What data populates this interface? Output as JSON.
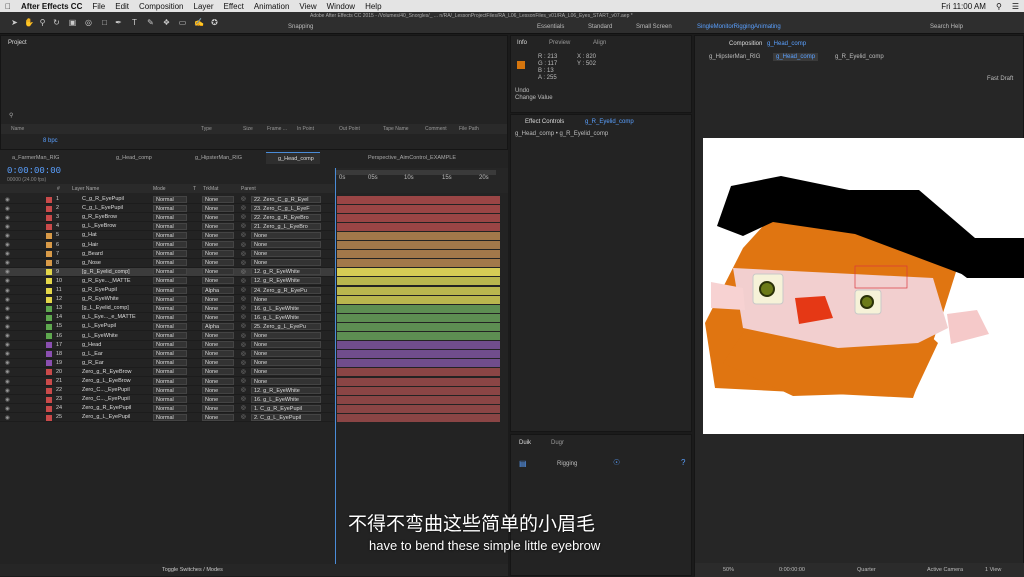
{
  "menubar": {
    "app": "After Effects CC",
    "items": [
      "File",
      "Edit",
      "Composition",
      "Layer",
      "Effect",
      "Animation",
      "View",
      "Window",
      "Help"
    ],
    "title": "Adobe After Effects CC 2015 - /Volumes/40_Snorgles/_ ... n/RA/_LessonProjectFiles/RA_L06_LessonFiles_v01/RA_L06_Eyes_START_v07.aep *",
    "clock": "Fri 11:00 AM"
  },
  "toolbar": {
    "snapping": "Snapping",
    "workspaces": [
      "Essentials",
      "Standard",
      "Small Screen",
      "SingleMonitorRiggingAnimating"
    ],
    "search": "Search Help"
  },
  "project": {
    "title": "Project",
    "bpc": "8 bpc",
    "columns": [
      "Name",
      "Type",
      "Size",
      "Frame ...",
      "In Point",
      "Out Point",
      "Tape Name",
      "Comment",
      "File Path"
    ]
  },
  "info": {
    "tabs": [
      "Info",
      "Preview",
      "Align"
    ],
    "r": "R : 213",
    "g": "G : 117",
    "b": "B : 13",
    "a": "A : 255",
    "x": "X : 820",
    "y": "Y : 502",
    "undo": "Undo",
    "undo_action": "Change Value"
  },
  "effects": {
    "title": "Effect Controls",
    "target": "g_R_Eyelid_comp",
    "breadcrumb": "g_Head_comp • g_R_Eyelid_comp"
  },
  "duik": {
    "tabs": [
      "Duik",
      "Dugr"
    ],
    "section": "Rigging"
  },
  "comp": {
    "title": "Composition",
    "name": "g_Head_comp",
    "tabs": [
      "g_HipsterMan_RIG",
      "g_Head_comp",
      "g_R_Eyelid_comp"
    ],
    "draft": "Fast Draft",
    "zoom": "50%",
    "time": "0:00:00:00",
    "quality": "Quarter",
    "camera": "Active Camera",
    "views": "1 View"
  },
  "timeline": {
    "tabs": [
      "a_FarmerMan_RIG",
      "g_Head_comp",
      "g_HipsterMan_RIG",
      "g_Head_comp",
      "Perspective_AimControl_EXAMPLE"
    ],
    "timecode": "0:00:00:00",
    "fps": "00000 (24.00 fps)",
    "columns": [
      "#",
      "Layer Name",
      "Mode",
      "T",
      "TrkMat",
      "Parent"
    ],
    "ruler": [
      "0s",
      "05s",
      "10s",
      "15s",
      "20s"
    ],
    "toggle": "Toggle Switches / Modes",
    "layers": [
      {
        "n": "1",
        "name": "C_g_R_EyePupil",
        "mode": "Normal",
        "trk": "None",
        "parent": "22. Zero_C_g_R_Eyel",
        "color": "#c94a4a",
        "bar": "#9a4545"
      },
      {
        "n": "2",
        "name": "C_g_L_EyePupil",
        "mode": "Normal",
        "trk": "None",
        "parent": "23. Zero_C_g_L_EyeF",
        "color": "#c94a4a",
        "bar": "#9a4545"
      },
      {
        "n": "3",
        "name": "g_R_EyeBrow",
        "mode": "Normal",
        "trk": "None",
        "parent": "22. Zero_g_R_EyeBro",
        "color": "#c94a4a",
        "bar": "#9a4545"
      },
      {
        "n": "4",
        "name": "g_L_EyeBrow",
        "mode": "Normal",
        "trk": "None",
        "parent": "21. Zero_g_L_EyeBro",
        "color": "#c94a4a",
        "bar": "#9a4545"
      },
      {
        "n": "5",
        "name": "g_Hat",
        "mode": "Normal",
        "trk": "None",
        "parent": "None",
        "color": "#d89a48",
        "bar": "#a2784a"
      },
      {
        "n": "6",
        "name": "g_Hair",
        "mode": "Normal",
        "trk": "None",
        "parent": "None",
        "color": "#d89a48",
        "bar": "#a2784a"
      },
      {
        "n": "7",
        "name": "g_Beard",
        "mode": "Normal",
        "trk": "None",
        "parent": "None",
        "color": "#d89a48",
        "bar": "#a2784a"
      },
      {
        "n": "8",
        "name": "g_Nose",
        "mode": "Normal",
        "trk": "None",
        "parent": "None",
        "color": "#d89a48",
        "bar": "#a2784a"
      },
      {
        "n": "9",
        "name": "[g_R_Eyelid_comp]",
        "mode": "Normal",
        "trk": "None",
        "parent": "12. g_R_EyeWhite",
        "color": "#e3d64a",
        "bar": "#d6cc55",
        "sel": true
      },
      {
        "n": "10",
        "name": "g_R_Eye..._MATTE",
        "mode": "Normal",
        "trk": "None",
        "parent": "12. g_R_EyeWhite",
        "color": "#e3d64a",
        "bar": "#b9b64e"
      },
      {
        "n": "11",
        "name": "g_R_EyePupil",
        "mode": "Normal",
        "trk": "Alpha",
        "parent": "24. Zero_g_R_EyePu",
        "color": "#e3d64a",
        "bar": "#b9b64e"
      },
      {
        "n": "12",
        "name": "g_R_EyeWhite",
        "mode": "Normal",
        "trk": "None",
        "parent": "None",
        "color": "#e3d64a",
        "bar": "#b9b64e"
      },
      {
        "n": "13",
        "name": "[g_L_Eyelid_comp]",
        "mode": "Normal",
        "trk": "None",
        "parent": "16. g_L_EyeWhite",
        "color": "#5fa84f",
        "bar": "#5d8e52"
      },
      {
        "n": "14",
        "name": "g_L_Eye..._e_MATTE",
        "mode": "Normal",
        "trk": "None",
        "parent": "16. g_L_EyeWhite",
        "color": "#5fa84f",
        "bar": "#5d8e52"
      },
      {
        "n": "15",
        "name": "g_L_EyePupil",
        "mode": "Normal",
        "trk": "Alpha",
        "parent": "25. Zero_g_L_EyePu",
        "color": "#5fa84f",
        "bar": "#5d8e52"
      },
      {
        "n": "16",
        "name": "g_L_EyeWhite",
        "mode": "Normal",
        "trk": "None",
        "parent": "None",
        "color": "#5fa84f",
        "bar": "#5d8e52"
      },
      {
        "n": "17",
        "name": "g_Head",
        "mode": "Normal",
        "trk": "None",
        "parent": "None",
        "color": "#8a4fb0",
        "bar": "#704d8c"
      },
      {
        "n": "18",
        "name": "g_L_Ear",
        "mode": "Normal",
        "trk": "None",
        "parent": "None",
        "color": "#8a4fb0",
        "bar": "#704d8c"
      },
      {
        "n": "19",
        "name": "g_R_Ear",
        "mode": "Normal",
        "trk": "None",
        "parent": "None",
        "color": "#8a4fb0",
        "bar": "#704d8c"
      },
      {
        "n": "20",
        "name": "Zero_g_R_EyeBrow",
        "mode": "Normal",
        "trk": "None",
        "parent": "None",
        "color": "#c94a4a",
        "bar": "#8a4545"
      },
      {
        "n": "21",
        "name": "Zero_g_L_EyeBrow",
        "mode": "Normal",
        "trk": "None",
        "parent": "None",
        "color": "#c94a4a",
        "bar": "#8a4545"
      },
      {
        "n": "22",
        "name": "Zero_C..._EyePupil",
        "mode": "Normal",
        "trk": "None",
        "parent": "12. g_R_EyeWhite",
        "color": "#c94a4a",
        "bar": "#8a4545"
      },
      {
        "n": "23",
        "name": "Zero_C..._EyePupil",
        "mode": "Normal",
        "trk": "None",
        "parent": "16. g_L_EyeWhite",
        "color": "#c94a4a",
        "bar": "#8a4545"
      },
      {
        "n": "24",
        "name": "Zero_g_R_EyePupil",
        "mode": "Normal",
        "trk": "None",
        "parent": "1. C_g_R_EyePupil",
        "color": "#c94a4a",
        "bar": "#8a4545"
      },
      {
        "n": "25",
        "name": "Zero_g_L_EyePupil",
        "mode": "Normal",
        "trk": "None",
        "parent": "2. C_g_L_EyePupil",
        "color": "#c94a4a",
        "bar": "#8a4545"
      }
    ]
  },
  "subtitle": {
    "zh": "不得不弯曲这些简单的小眉毛",
    "en": "have to bend these simple little eyebrow"
  }
}
